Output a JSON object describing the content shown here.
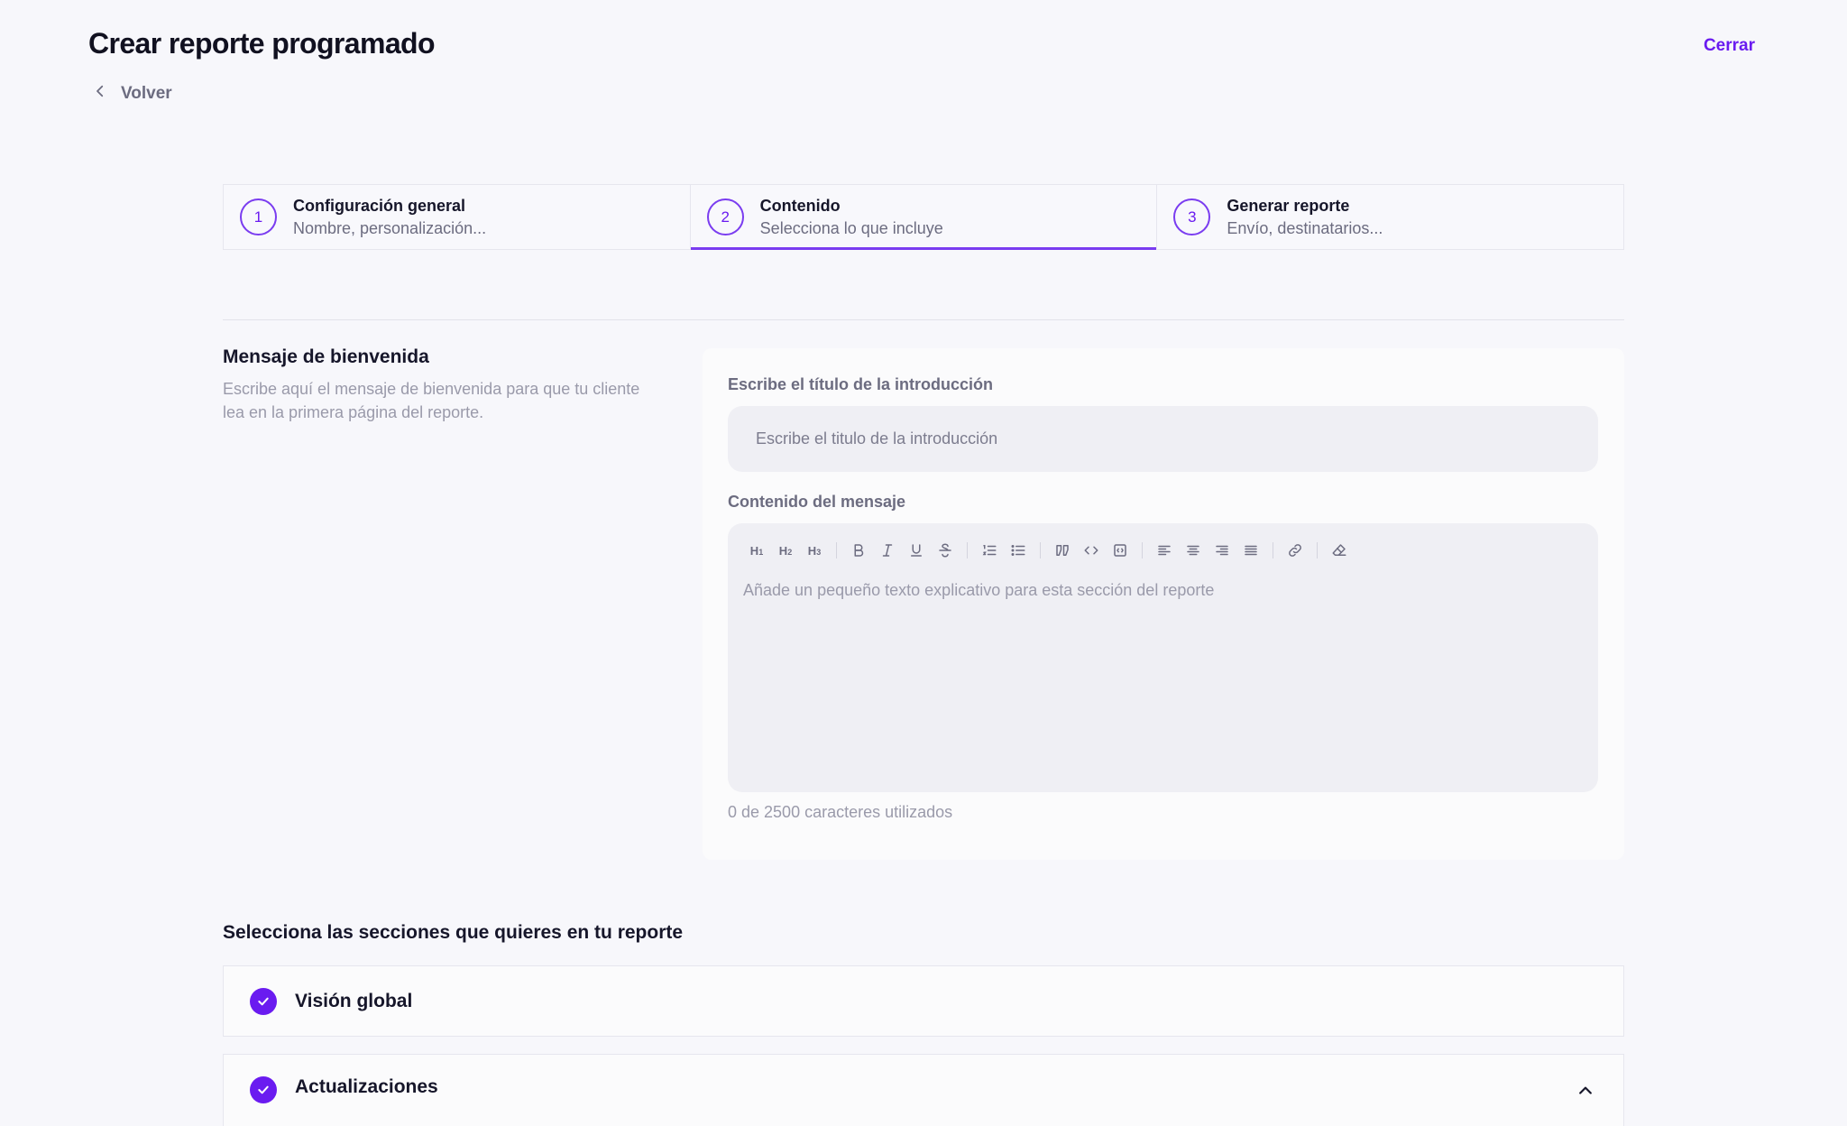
{
  "header": {
    "title": "Crear reporte programado",
    "close_label": "Cerrar",
    "back_label": "Volver"
  },
  "stepper": {
    "steps": [
      {
        "number": "1",
        "title": "Configuración general",
        "subtitle": "Nombre, personalización...",
        "active": false
      },
      {
        "number": "2",
        "title": "Contenido",
        "subtitle": "Selecciona lo que incluye",
        "active": true
      },
      {
        "number": "3",
        "title": "Generar reporte",
        "subtitle": "Envío, destinatarios...",
        "active": false
      }
    ]
  },
  "welcome": {
    "title": "Mensaje de bienvenida",
    "description": "Escribe aquí el mensaje de bienvenida para que tu cliente lea en la primera página del reporte.",
    "intro_title_label": "Escribe el título de la introducción",
    "intro_title_placeholder": "Escribe el titulo de la introducción",
    "intro_title_value": "",
    "content_label": "Contenido del mensaje",
    "content_placeholder": "Añade un pequeño texto explicativo para esta sección del reporte",
    "counter": "0 de 2500 caracteres utilizados"
  },
  "toolbar": {
    "buttons": [
      "heading-1",
      "heading-2",
      "heading-3",
      "bold",
      "italic",
      "underline",
      "strikethrough",
      "ordered-list",
      "bullet-list",
      "blockquote",
      "code",
      "code-block",
      "align-left",
      "align-center",
      "align-right",
      "align-justify",
      "link",
      "clear-format"
    ]
  },
  "sections": {
    "title": "Selecciona las secciones que quieres en tu reporte",
    "items": [
      {
        "label": "Visión global",
        "checked": true
      },
      {
        "label": "Actualizaciones",
        "checked": true,
        "expanded": true
      }
    ]
  },
  "colors": {
    "accent": "#6a1bf0",
    "background": "#f7f7fb"
  }
}
